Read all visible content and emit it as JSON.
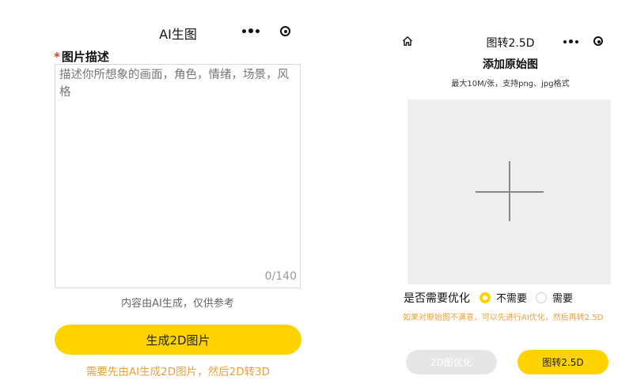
{
  "left": {
    "title": "AI生图",
    "field_label": "图片描述",
    "required_mark": "*",
    "textarea_placeholder": "描述你所想象的画面，角色，情绪，场景，风格",
    "textarea_value": "",
    "counter": "0/140",
    "note": "内容由AI生成，仅供参考",
    "generate_button": "生成2D图片",
    "hint": "需要先由AI生成2D图片，然后2D转3D",
    "icons": [
      "more-dots-icon",
      "target-icon"
    ]
  },
  "right": {
    "title": "图转2.5D",
    "heading": "添加原始图",
    "subheading": "最大10M/张，支持png、jpg格式",
    "optimize_question": "是否需要优化",
    "options": [
      {
        "label": "不需要",
        "selected": true
      },
      {
        "label": "需要",
        "selected": false
      }
    ],
    "hint": "如果对原始图不满意，可以先进行AI优化，然后再转2.5D",
    "optimize_button": "2D图优化",
    "convert_button": "图转2.5D",
    "icons": [
      "home-icon",
      "more-dots-icon",
      "target-icon",
      "add-plus-icon"
    ]
  },
  "colors": {
    "accent": "#ffd300",
    "hint": "#e8a13d",
    "required": "#e5392f",
    "disabled": "#e6e6e6"
  }
}
